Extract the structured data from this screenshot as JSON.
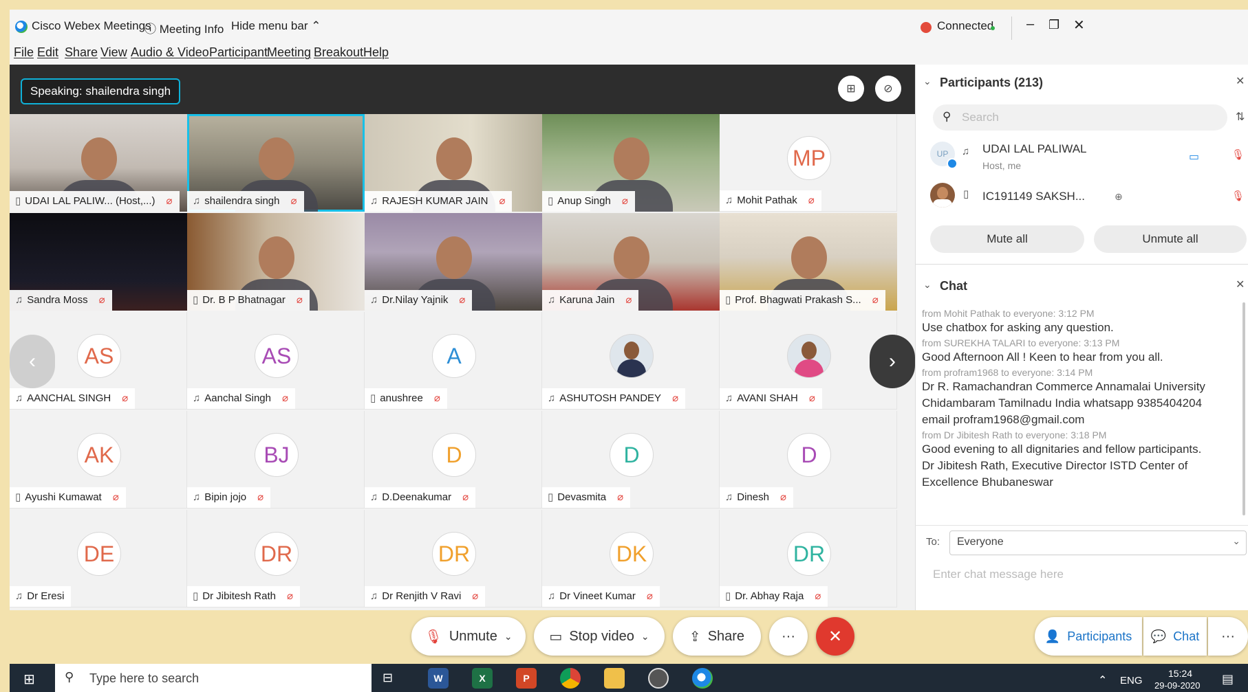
{
  "titlebar": {
    "app_name": "Cisco Webex Meetings",
    "meeting_info": "Meeting Info",
    "hide_menu": "Hide menu bar",
    "status": "Connected",
    "status_color": "#2fb04a",
    "record_color": "#e34b3b"
  },
  "menu": [
    "File",
    "Edit",
    "Share",
    "View",
    "Audio & Video",
    "Participant",
    "Meeting",
    "Breakout",
    "Help"
  ],
  "speaking": "Speaking: shailendra singh",
  "video_tiles": [
    {
      "name": "UDAI LAL PALIW... (Host,...)",
      "type": "photo"
    },
    {
      "name": "shailendra singh",
      "type": "photo",
      "active": true
    },
    {
      "name": "RAJESH KUMAR JAIN",
      "type": "photo"
    },
    {
      "name": "Anup Singh",
      "type": "photo"
    },
    {
      "name": "Mohit Pathak",
      "type": "avatar",
      "initials": "MP",
      "color": "#e0694b"
    },
    {
      "name": "Sandra Moss",
      "type": "photo"
    },
    {
      "name": "Dr. B P Bhatnagar",
      "type": "photo"
    },
    {
      "name": "Dr.Nilay Yajnik",
      "type": "photo"
    },
    {
      "name": "Karuna Jain",
      "type": "photo"
    },
    {
      "name": "Prof. Bhagwati Prakash S...",
      "type": "photo"
    },
    {
      "name": "AANCHAL SINGH",
      "type": "avatar",
      "initials": "AS",
      "color": "#e0694b"
    },
    {
      "name": "Aanchal Singh",
      "type": "avatar",
      "initials": "AS",
      "color": "#a84bb5"
    },
    {
      "name": "anushree",
      "type": "avatar",
      "initials": "A",
      "color": "#2e8fd6"
    },
    {
      "name": "ASHUTOSH PANDEY",
      "type": "avatar-photo"
    },
    {
      "name": "AVANI SHAH",
      "type": "avatar-photo"
    },
    {
      "name": "Ayushi Kumawat",
      "type": "avatar",
      "initials": "AK",
      "color": "#e0694b"
    },
    {
      "name": "Bipin jojo",
      "type": "avatar",
      "initials": "BJ",
      "color": "#a84bb5"
    },
    {
      "name": "D.Deenakumar",
      "type": "avatar",
      "initials": "D",
      "color": "#f0a02c"
    },
    {
      "name": "Devasmita",
      "type": "avatar",
      "initials": "D",
      "color": "#2fb3a0"
    },
    {
      "name": "Dinesh",
      "type": "avatar",
      "initials": "D",
      "color": "#a84bb5"
    },
    {
      "name": "Dr Eresi",
      "type": "avatar",
      "initials": "DE",
      "color": "#e0694b"
    },
    {
      "name": "Dr Jibitesh Rath",
      "type": "avatar",
      "initials": "DR",
      "color": "#e0694b"
    },
    {
      "name": "Dr Renjith V Ravi",
      "type": "avatar",
      "initials": "DR",
      "color": "#f0a02c"
    },
    {
      "name": "Dr Vineet Kumar",
      "type": "avatar",
      "initials": "DK",
      "color": "#f0a02c"
    },
    {
      "name": "Dr. Abhay Raja",
      "type": "avatar",
      "initials": "DR",
      "color": "#2fb3a0"
    }
  ],
  "controls": {
    "unmute": "Unmute",
    "stop_video": "Stop video",
    "share": "Share",
    "more": "···",
    "participants": "Participants",
    "chat": "Chat"
  },
  "participants": {
    "title": "Participants (213)",
    "search_placeholder": "Search",
    "list": [
      {
        "name": "UDAI LAL PALIWAL",
        "sub": "Host, me",
        "initials": "UP"
      },
      {
        "name": "IC191149 SAKSH...",
        "sub": ""
      }
    ],
    "mute_all": "Mute all",
    "unmute_all": "Unmute all"
  },
  "chat": {
    "title": "Chat",
    "messages": [
      {
        "meta": "from Mohit Pathak to everyone:   3:12 PM",
        "lines": [
          "Use chatbox for asking any question."
        ]
      },
      {
        "meta": "from SUREKHA TALARI to everyone:   3:13 PM",
        "lines": [
          "Good Afternoon All ! Keen to hear from you all."
        ]
      },
      {
        "meta": "from profram1968 to everyone:   3:14 PM",
        "lines": [
          "Dr R. Ramachandran Commerce Annamalai University",
          "Chidambaram Tamilnadu India whatsapp 9385404204",
          "email profram1968@gmail.com"
        ]
      },
      {
        "meta": "from Dr Jibitesh Rath to everyone:   3:18 PM",
        "lines": [
          "Good evening to all dignitaries and fellow participants.",
          "Dr Jibitesh Rath, Executive Director ISTD Center of",
          "Excellence Bhubaneswar"
        ]
      }
    ],
    "to_label": "To:",
    "to_value": "Everyone",
    "input_placeholder": "Enter chat message here"
  },
  "taskbar": {
    "search_placeholder": "Type here to search",
    "lang": "ENG",
    "time": "15:24",
    "date": "29-09-2020"
  }
}
